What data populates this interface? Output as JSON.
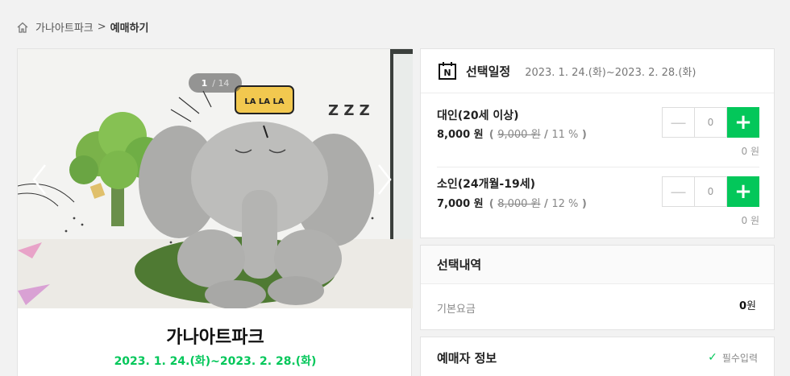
{
  "breadcrumb": {
    "home_icon": "home-icon",
    "parent": "가나아트파크",
    "separator": ">",
    "current": "예매하기"
  },
  "gallery": {
    "current_page": "1",
    "page_separator": "/",
    "total_pages": "14",
    "sign_text": "LA LA LA",
    "snore_text": "Z Z Z"
  },
  "venue": {
    "title": "가나아트파크",
    "dates": "2023. 1. 24.(화)~2023. 2. 28.(화)"
  },
  "schedule": {
    "title": "선택일정",
    "range": "2023. 1. 24.(화)~2023. 2. 28.(화)",
    "icon_letter": "N"
  },
  "tickets": [
    {
      "name": "대인(20세 이상)",
      "sale_price": "8,000 원",
      "original_price": "9,000 원",
      "discount": "11 %",
      "quantity": "0",
      "subtotal": "0 원"
    },
    {
      "name": "소인(24개월-19세)",
      "sale_price": "7,000 원",
      "original_price": "8,000 원",
      "discount": "12 %",
      "quantity": "0",
      "subtotal": "0 원"
    }
  ],
  "selection": {
    "title": "선택내역",
    "base_fee_label": "기본요금",
    "base_fee_amount": "0",
    "base_fee_unit": "원"
  },
  "booker": {
    "title": "예매자 정보",
    "required_label": "필수입력"
  },
  "colors": {
    "accent": "#03c75a",
    "background": "#f2f2f2"
  }
}
